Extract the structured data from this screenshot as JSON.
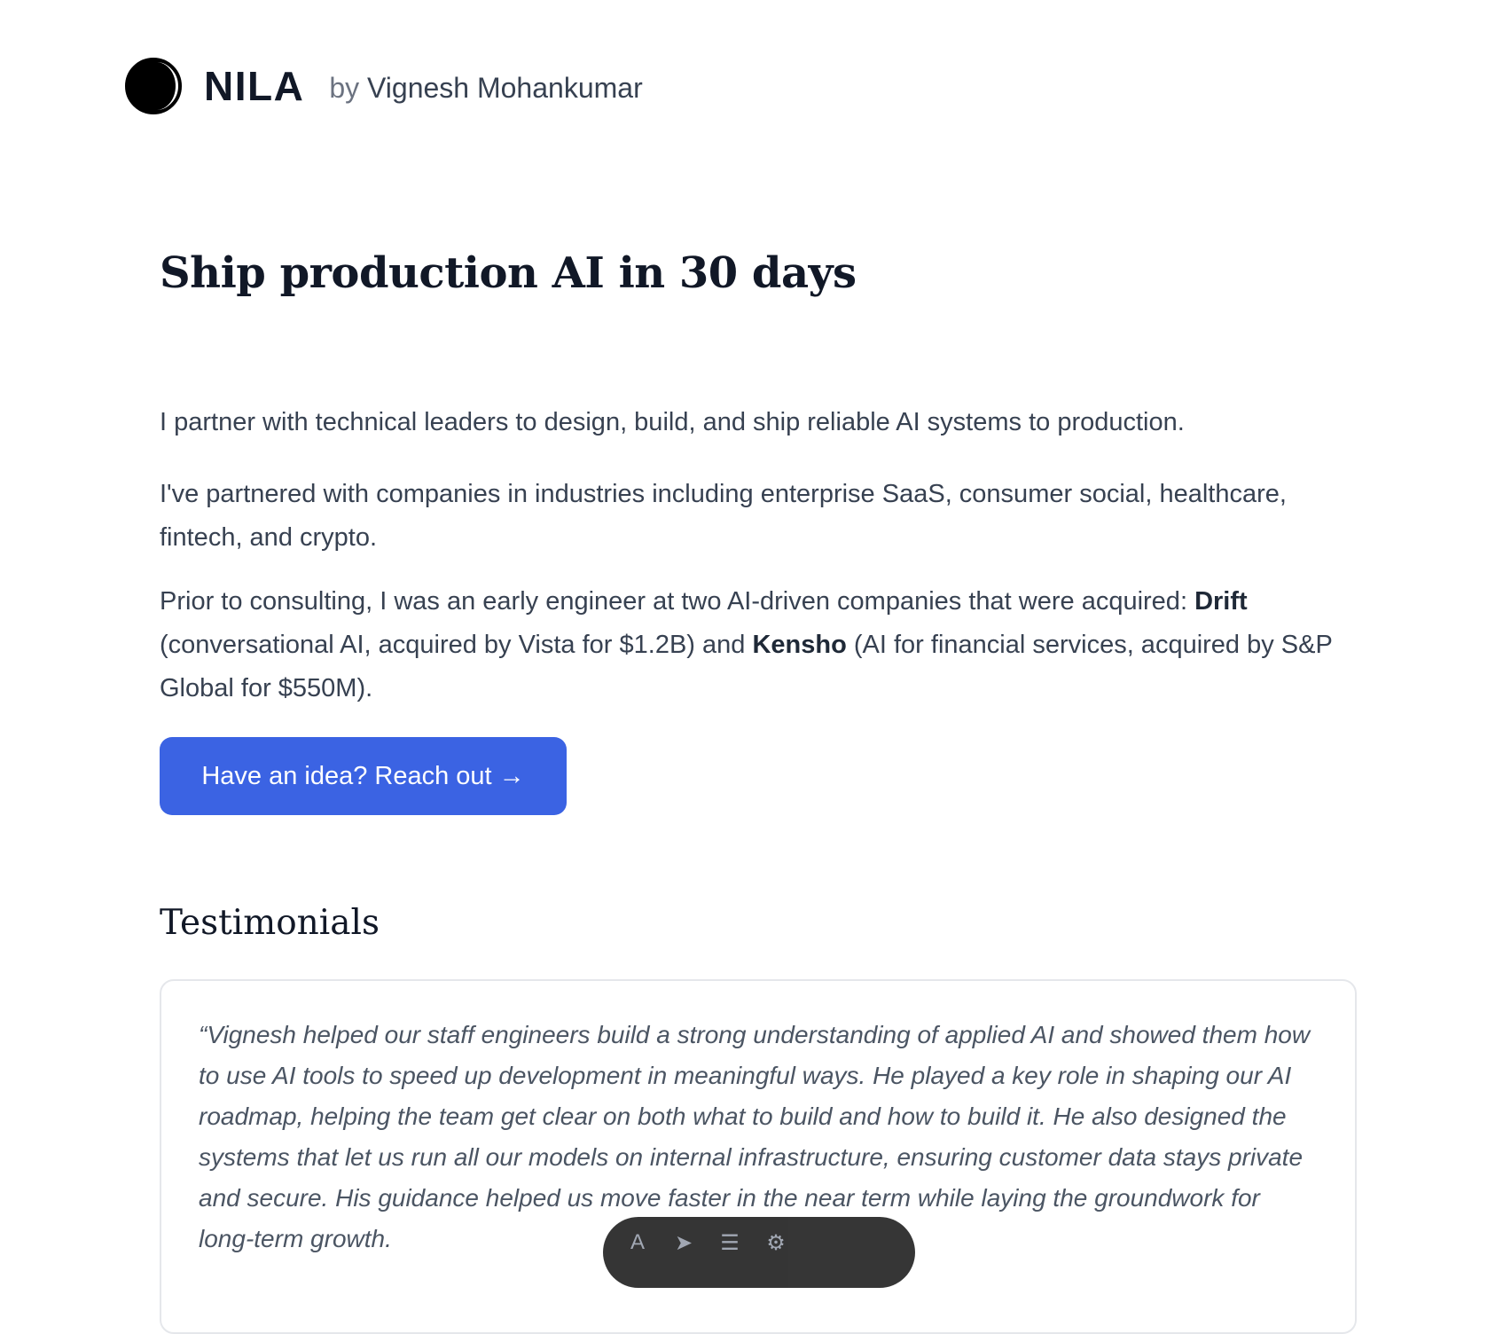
{
  "header": {
    "brand": "NILA",
    "by": "by",
    "author": "Vignesh Mohankumar"
  },
  "hero": {
    "title": "Ship production AI in 30 days",
    "p1": "I partner with technical leaders to design, build, and ship reliable AI systems to production.",
    "p2": "I've partnered with companies in industries including enterprise SaaS, consumer social, healthcare, fintech, and crypto.",
    "p3_a": "Prior to consulting, I was an early engineer at two AI-driven companies that were acquired: ",
    "p3_drift": "Drift",
    "p3_b": " (conversational AI, acquired by Vista for $1.2B) and ",
    "p3_kensho": "Kensho",
    "p3_c": " (AI for financial services, acquired by S&P Global for $550M).",
    "cta_label": "Have an idea? Reach out →"
  },
  "testimonials": {
    "heading": "Testimonials",
    "quote": "“Vignesh helped our staff engineers build a strong understanding of applied AI and showed them how to use AI tools to speed up development in meaningful ways. He played a key role in shaping our AI roadmap, helping the team get clear on both what to build and how to build it. He also designed the systems that let us run all our models on internal infrastructure, ensuring customer data stays private and secure. His guidance helped us move faster in the near term while laying the groundwork for long-term growth."
  },
  "toolbar": {
    "icons": [
      "text-icon",
      "send-icon",
      "menu-icon",
      "gear-icon"
    ]
  }
}
